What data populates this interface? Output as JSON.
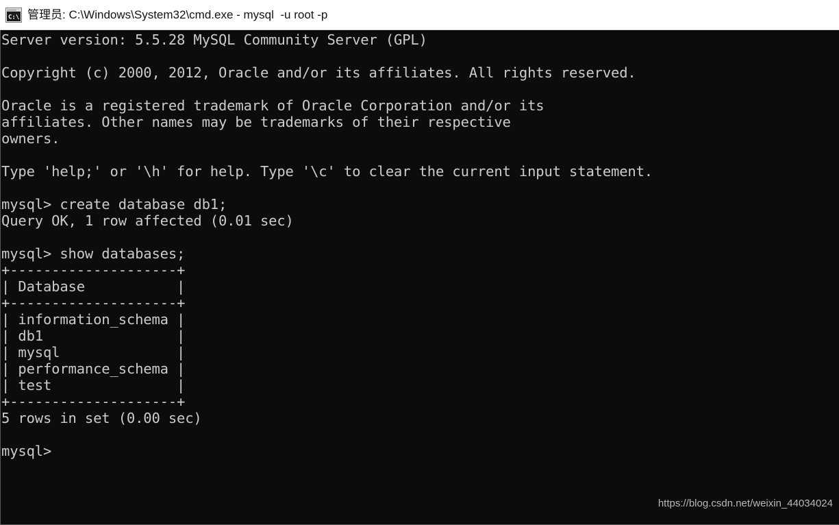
{
  "window": {
    "title": "管理员: C:\\Windows\\System32\\cmd.exe - mysql  -u root -p",
    "icon": "cmd-console-icon",
    "background_color": "#0c0c0c",
    "text_color": "#cccccc",
    "titlebar_color": "#ffffff",
    "titlebar_text_color": "#121212"
  },
  "terminal": {
    "lines": [
      "Server version: 5.5.28 MySQL Community Server (GPL)",
      "",
      "Copyright (c) 2000, 2012, Oracle and/or its affiliates. All rights reserved.",
      "",
      "Oracle is a registered trademark of Oracle Corporation and/or its",
      "affiliates. Other names may be trademarks of their respective",
      "owners.",
      "",
      "Type 'help;' or '\\h' for help. Type '\\c' to clear the current input statement.",
      "",
      "mysql> create database db1;",
      "Query OK, 1 row affected (0.01 sec)",
      "",
      "mysql> show databases;",
      "+--------------------+",
      "| Database           |",
      "+--------------------+",
      "| information_schema |",
      "| db1                |",
      "| mysql              |",
      "| performance_schema |",
      "| test               |",
      "+--------------------+",
      "5 rows in set (0.00 sec)",
      "",
      "mysql>"
    ],
    "server_version": "5.5.28",
    "server_product": "MySQL Community Server (GPL)",
    "copyright": "Copyright (c) 2000, 2012, Oracle and/or its affiliates. All rights reserved.",
    "prompt": "mysql>",
    "commands": [
      {
        "prompt": "mysql>",
        "command": "create database db1;",
        "result": "Query OK, 1 row affected (0.01 sec)"
      },
      {
        "prompt": "mysql>",
        "command": "show databases;",
        "result": "5 rows in set (0.00 sec)"
      }
    ],
    "result_table": {
      "column": "Database",
      "rows": [
        "information_schema",
        "db1",
        "mysql",
        "performance_schema",
        "test"
      ],
      "row_count": 5,
      "elapsed": "0.00 sec"
    }
  },
  "watermark": {
    "text": "https://blog.csdn.net/weixin_44034024"
  }
}
